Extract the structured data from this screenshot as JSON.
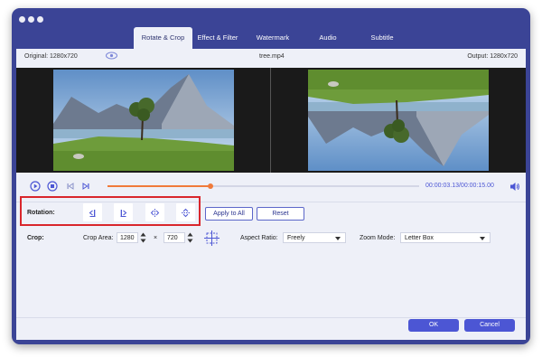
{
  "tabs": [
    "Rotate & Crop",
    "Effect & Filter",
    "Watermark",
    "Audio",
    "Subtitle"
  ],
  "info": {
    "original": "Original: 1280x720",
    "filename": "tree.mp4",
    "output": "Output: 1280x720"
  },
  "player": {
    "time": "00:00:03.13/00:00:15.00",
    "progress": 0.33
  },
  "rotation": {
    "label": "Rotation:",
    "apply_all": "Apply to All",
    "reset": "Reset"
  },
  "crop": {
    "label": "Crop:",
    "area_label": "Crop Area:",
    "width": "1280",
    "times": "×",
    "height": "720",
    "aspect_label": "Aspect Ratio:",
    "aspect_value": "Freely",
    "zoom_label": "Zoom Mode:",
    "zoom_value": "Letter Box"
  },
  "footer": {
    "ok": "OK",
    "cancel": "Cancel"
  },
  "colors": {
    "accent": "#4c56d4",
    "highlight": "#d9262c",
    "window": "#3b4496",
    "progress": "#f07a3a"
  }
}
